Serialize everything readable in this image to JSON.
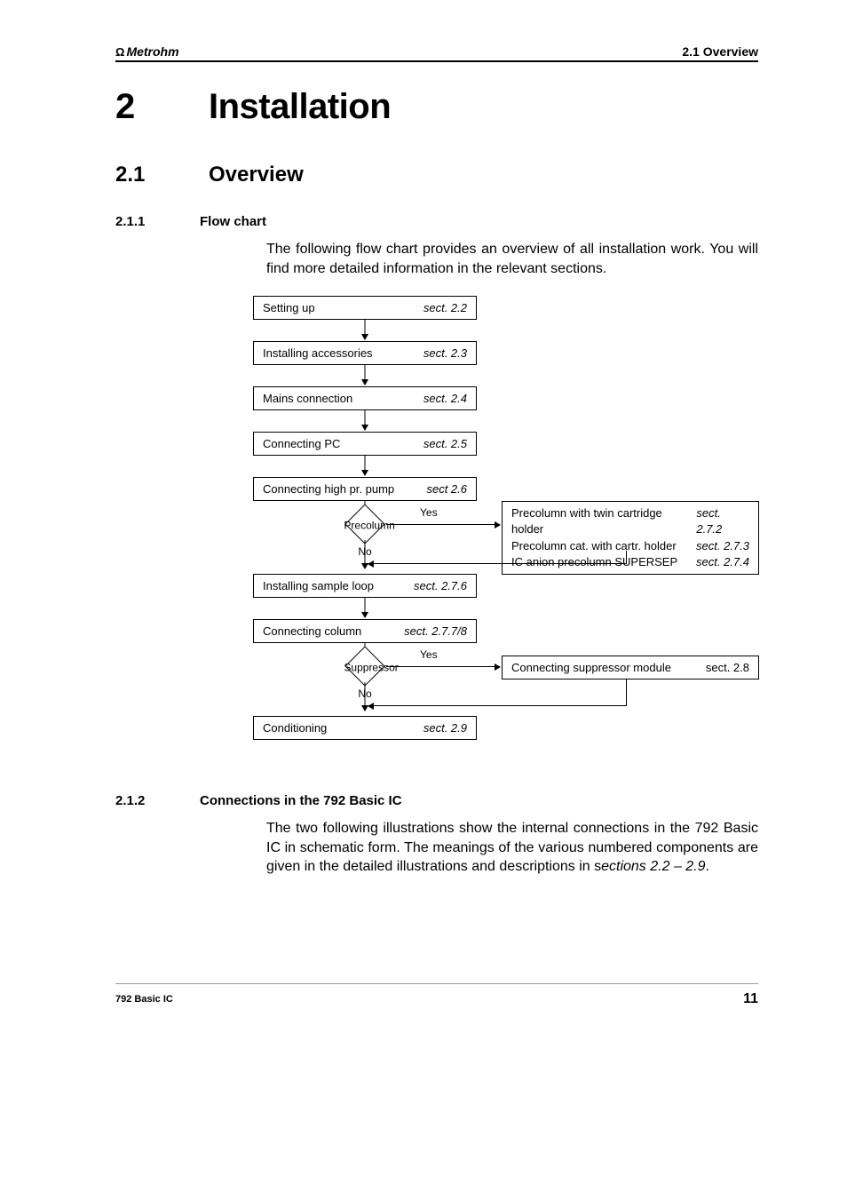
{
  "header": {
    "logo": "Metrohm",
    "logo_symbol": "Ω",
    "right": "2.1 Overview"
  },
  "chapter": {
    "number": "2",
    "title": "Installation"
  },
  "section21": {
    "number": "2.1",
    "title": "Overview"
  },
  "section211": {
    "number": "2.1.1",
    "title": "Flow chart",
    "body": "The following flow chart provides an overview of all installation work. You will find more detailed information in the relevant sections."
  },
  "flowchart": {
    "boxes": [
      {
        "label": "Setting up",
        "sect": "sect. 2.2"
      },
      {
        "label": "Installing accessories",
        "sect": "sect. 2.3"
      },
      {
        "label": "Mains connection",
        "sect": "sect. 2.4"
      },
      {
        "label": "Connecting PC",
        "sect": "sect. 2.5"
      },
      {
        "label": "Connecting high pr. pump",
        "sect": "sect 2.6"
      }
    ],
    "decision1": {
      "label": "Precolumn",
      "yes": "Yes",
      "no": "No",
      "side": [
        {
          "label": "Precolumn with twin cartridge holder",
          "sect": "sect. 2.7.2"
        },
        {
          "label": "Precolumn cat. with cartr. holder",
          "sect": "sect. 2.7.3"
        },
        {
          "label": "IC anion precolumn SUPERSEP",
          "sect": "sect. 2.7.4"
        }
      ]
    },
    "boxes2": [
      {
        "label": "Installing sample loop",
        "sect": "sect. 2.7.6"
      },
      {
        "label": "Connecting column",
        "sect": "sect. 2.7.7/8"
      }
    ],
    "decision2": {
      "label": "Suppressor",
      "yes": "Yes",
      "no": "No",
      "side": {
        "label": "Connecting suppressor module",
        "sect": "sect. 2.8"
      }
    },
    "boxes3": [
      {
        "label": "Conditioning",
        "sect": "sect. 2.9"
      }
    ]
  },
  "section212": {
    "number": "2.1.2",
    "title": "Connections in the 792 Basic IC",
    "body_part1": "The two following illustrations show the internal connections in the 792 Basic IC in schematic form. The meanings of the various numbered components are given in the detailed illustrations and descriptions in s",
    "body_part2": "ections 2.2 – 2.9",
    "body_part3": "."
  },
  "footer": {
    "left": "792 Basic IC",
    "page": "11"
  }
}
